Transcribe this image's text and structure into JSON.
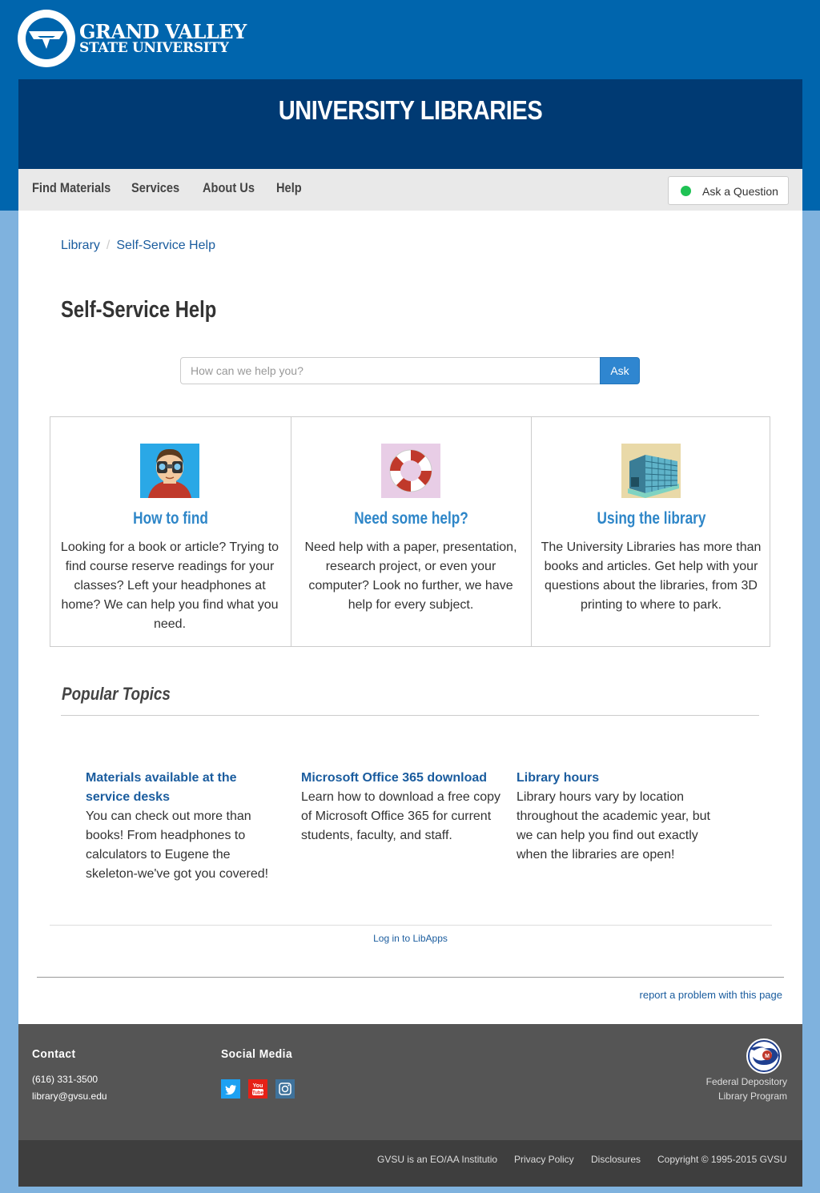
{
  "header": {
    "logo_line1": "GRAND VALLEY",
    "logo_line2": "STATE UNIVERSITY",
    "banner_title": "UNIVERSITY LIBRARIES"
  },
  "nav": {
    "items": [
      "Find Materials",
      "Services",
      "About Us",
      "Help"
    ],
    "ask_button": "Ask a Question",
    "ask_status_color": "#1fc254"
  },
  "breadcrumb": {
    "items": [
      "Library",
      "Self-Service Help"
    ],
    "separator": "/"
  },
  "page_title": "Self-Service Help",
  "search": {
    "placeholder": "How can we help you?",
    "button": "Ask"
  },
  "cards": [
    {
      "icon": "binoculars-person-icon",
      "title": "How to find",
      "text": "Looking for a book or article? Trying to find course reserve readings for your classes? Left your headphones at home? We can help you find what you need."
    },
    {
      "icon": "life-preserver-icon",
      "title": "Need some help?",
      "text": "Need help with a paper, presentation, research project, or even your computer? Look no further, we have help for every subject."
    },
    {
      "icon": "library-building-icon",
      "title": "Using the library",
      "text": "The University Libraries has more than books and articles. Get help with your questions about the libraries, from 3D printing to where to park."
    }
  ],
  "popular": {
    "title": "Popular Topics",
    "topics": [
      {
        "title": "Materials available at the service desks",
        "text": "You can check out more than books! From headphones to calculators to Eugene the skeleton-we've got you covered!"
      },
      {
        "title": "Microsoft Office 365 download",
        "text": "Learn how to download a free copy of Microsoft Office 365 for current students, faculty, and staff."
      },
      {
        "title": "Library hours",
        "text": "Library hours vary by location throughout the academic year, but we can help you find out exactly when the libraries are open!"
      }
    ]
  },
  "libapps_link": "Log in to LibApps",
  "report_link": "report a problem with this page",
  "footer": {
    "contact_title": "Contact",
    "phone": "(616) 331-3500",
    "email": "library@gvsu.edu",
    "social_title": "Social Media",
    "social_icons": [
      "twitter-icon",
      "youtube-icon",
      "instagram-icon"
    ],
    "fdlp_line1": "Federal Depository",
    "fdlp_line2": "Library Program"
  },
  "bottom_links": [
    "GVSU is an EO/AA Institutio",
    "Privacy Policy",
    "Disclosures",
    "Copyright © 1995-2015 GVSU"
  ],
  "colors": {
    "brand_blue": "#0065ad",
    "banner_navy": "#003a73",
    "link_blue": "#1a5c9e",
    "card_title_blue": "#2e86c8",
    "ask_button_blue": "#2f86d0"
  }
}
